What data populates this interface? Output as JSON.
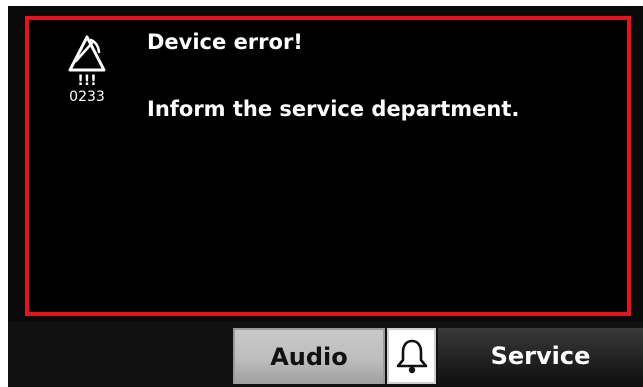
{
  "alarm": {
    "icon": "muted-alarm-triangle-icon",
    "marks": "!!!",
    "code": "0233",
    "title": "Device error!",
    "message": "Inform the service department.",
    "border_color": "#e4141e"
  },
  "toolbar": {
    "audio_label": "Audio",
    "bell_icon": "bell-icon",
    "service_label": "Service"
  }
}
